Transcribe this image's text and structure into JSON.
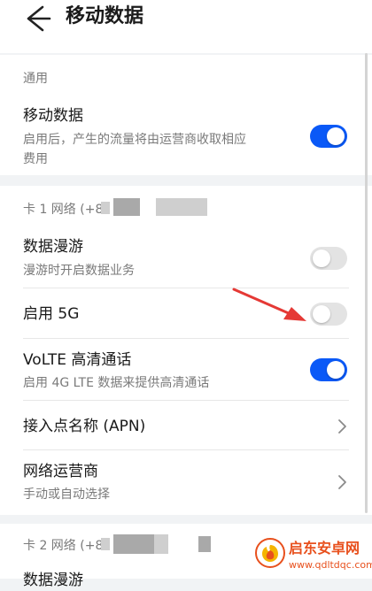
{
  "header": {
    "title": "移动数据"
  },
  "general": {
    "section_label": "通用",
    "mobile_data": {
      "title": "移动数据",
      "subtitle_line1": "启用后，产生的流量将由运营商收取相应",
      "subtitle_line2": "费用",
      "enabled": true
    }
  },
  "sim1": {
    "section_label": "卡 1 网络 (+8",
    "data_roaming": {
      "title": "数据漫游",
      "subtitle": "漫游时开启数据业务",
      "enabled": false
    },
    "enable_5g": {
      "title": "启用 5G",
      "enabled": false
    },
    "volte": {
      "title": "VoLTE 高清通话",
      "subtitle": "启用 4G LTE 数据来提供高清通话",
      "enabled": true
    },
    "apn": {
      "title": "接入点名称 (APN)"
    },
    "carrier": {
      "title": "网络运营商",
      "subtitle": "手动或自动选择"
    }
  },
  "sim2": {
    "section_label": "卡 2 网络 (+8",
    "partial_item": "数据漫游"
  },
  "watermark": {
    "name": "启东安卓网",
    "url": "www.qdltdqc.com"
  },
  "colors": {
    "accent": "#0a59f7",
    "background": "#f1f3f5",
    "watermark": "#e8501d",
    "annotation_arrow": "#e53935"
  }
}
